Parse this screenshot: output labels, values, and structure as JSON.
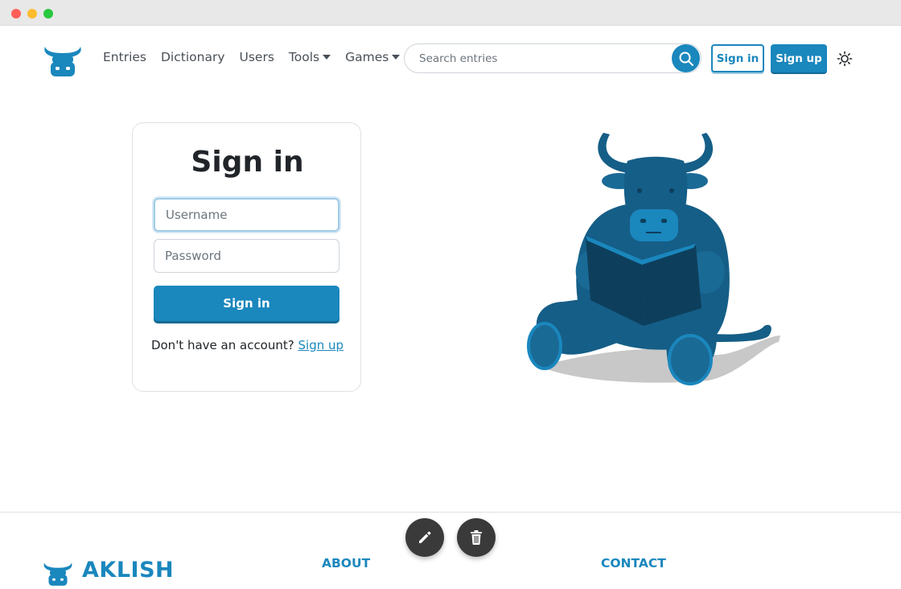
{
  "colors": {
    "accent": "#1a87bd",
    "accent_dark": "#136a94",
    "bull": "#155e87",
    "fab": "#3a3a3a"
  },
  "nav": {
    "logo_icon": "bull-logo-icon",
    "links": [
      {
        "label": "Entries"
      },
      {
        "label": "Dictionary"
      },
      {
        "label": "Users"
      },
      {
        "label": "Tools",
        "dropdown": true
      },
      {
        "label": "Games",
        "dropdown": true
      }
    ],
    "search": {
      "placeholder": "Search entries",
      "icon": "search-icon"
    },
    "signin_label": "Sign in",
    "signup_label": "Sign up",
    "theme_icon": "sun-icon"
  },
  "signin": {
    "title": "Sign in",
    "username_placeholder": "Username",
    "password_placeholder": "Password",
    "submit_label": "Sign in",
    "no_account_text": "Don't have an account?",
    "signup_link": "Sign up"
  },
  "illustration": {
    "icon": "bull-reading-book-icon"
  },
  "footer": {
    "brand": "AKLISH",
    "about_heading": "ABOUT",
    "contact_heading": "CONTACT"
  },
  "fabs": {
    "edit_icon": "pencil-icon",
    "delete_icon": "trash-icon"
  }
}
